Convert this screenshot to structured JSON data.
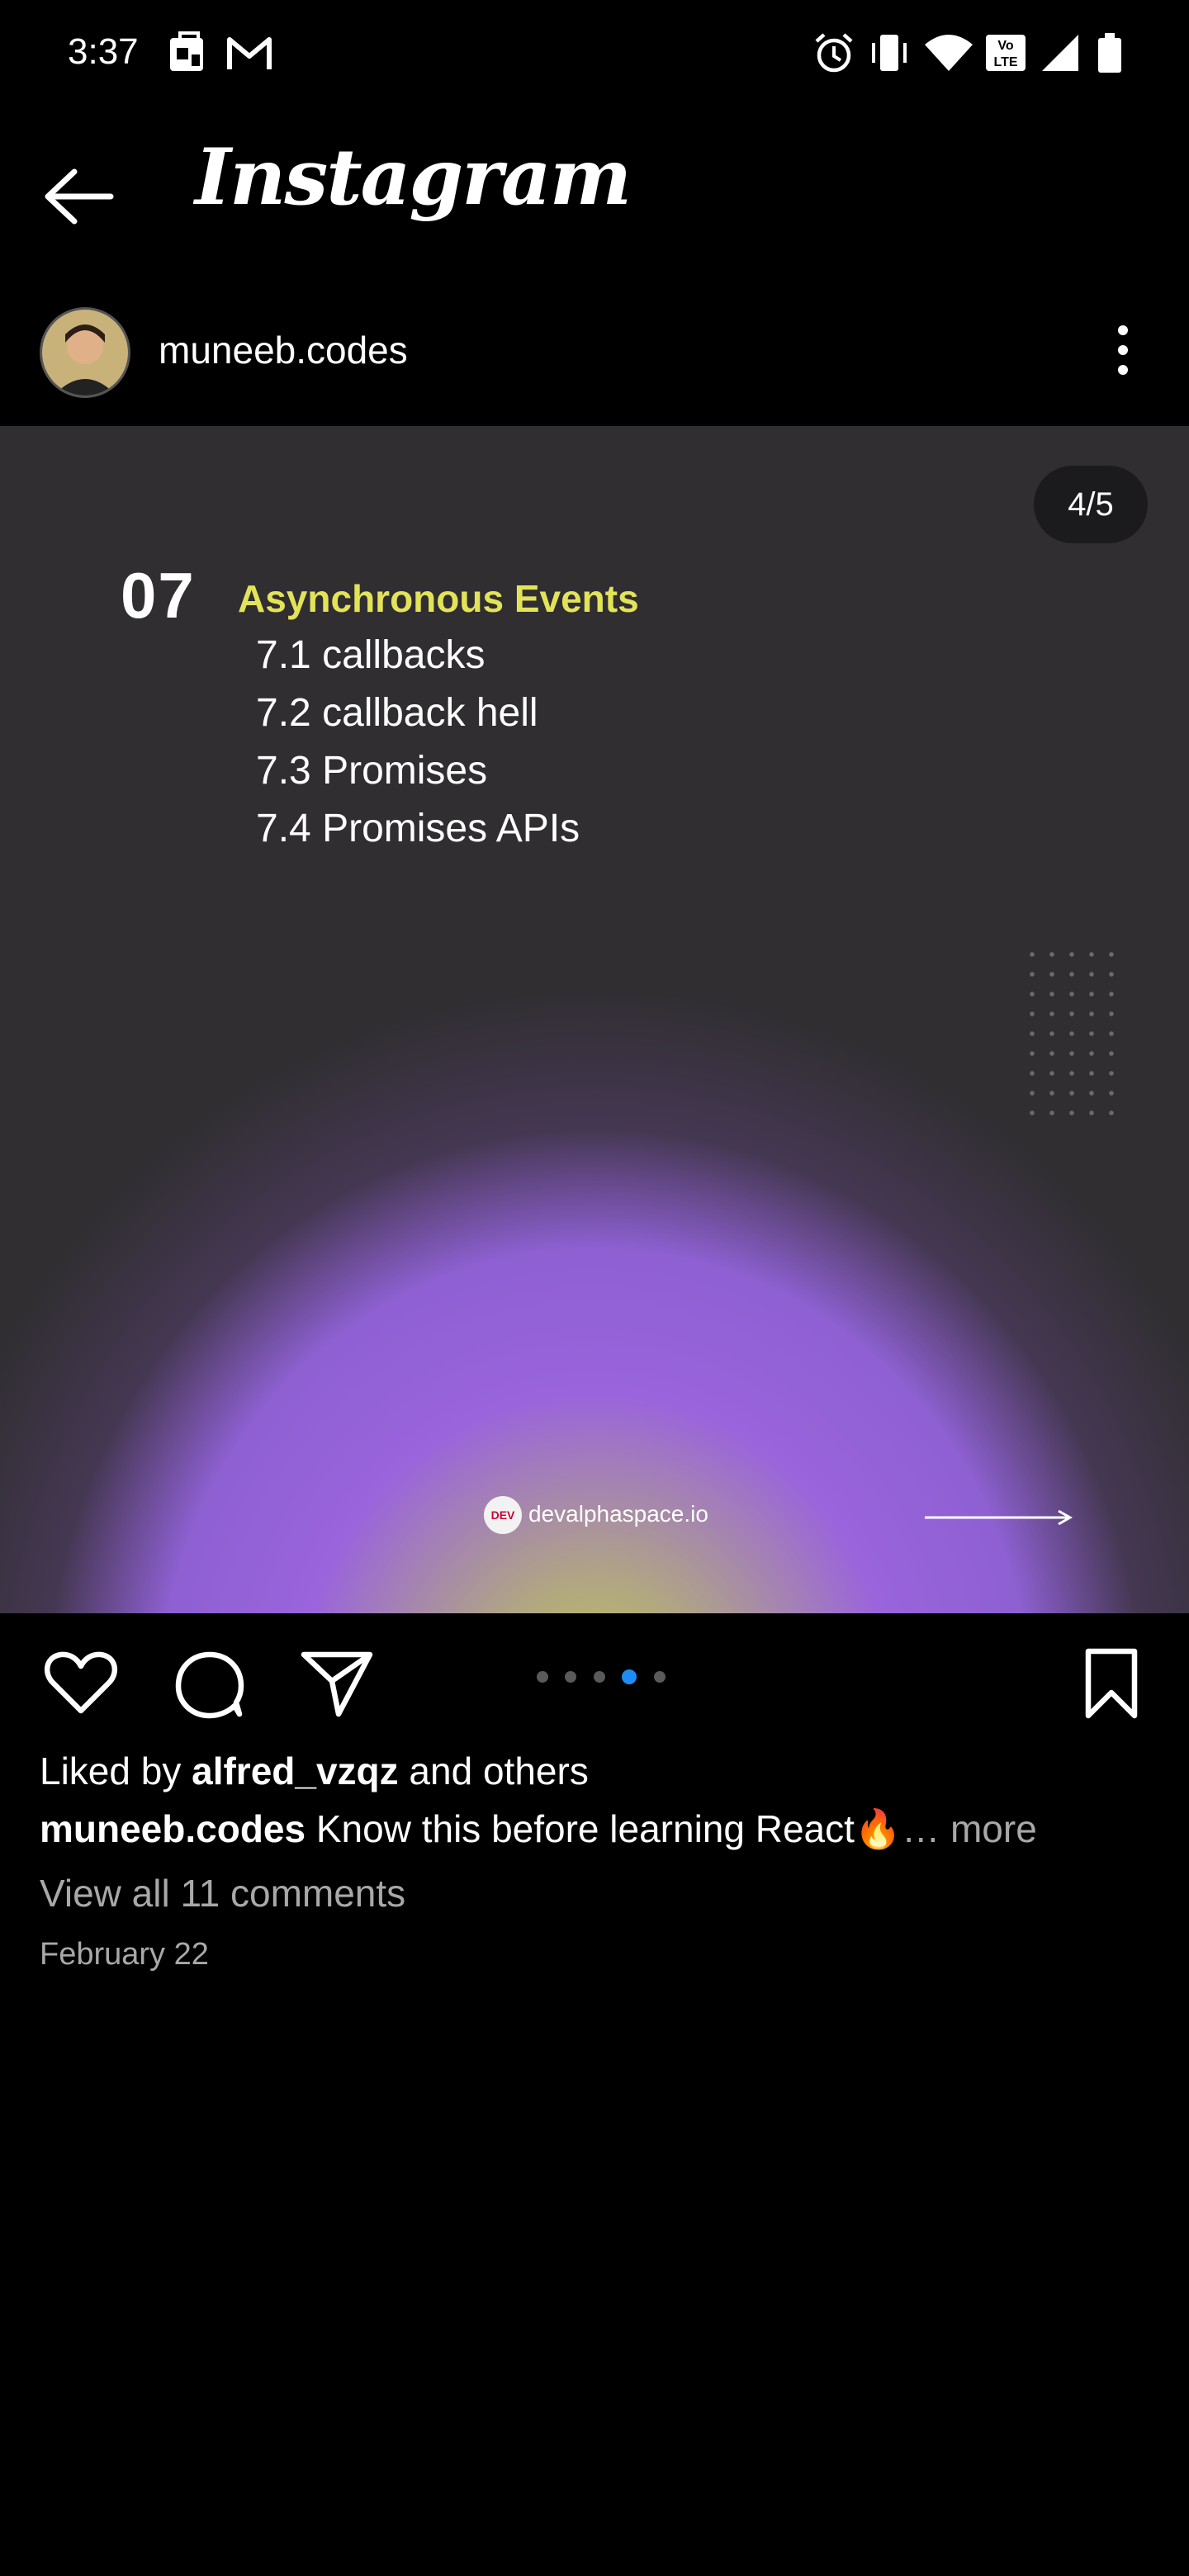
{
  "status_bar": {
    "time": "3:37",
    "left_icons": [
      "notification-icon",
      "gmail-icon"
    ],
    "right_icons": [
      "alarm-icon",
      "vibrate-icon",
      "wifi-icon",
      "volte-icon",
      "signal-icon",
      "battery-icon"
    ]
  },
  "header": {
    "app_title": "Instagram",
    "back_icon": "arrow-left-icon"
  },
  "post": {
    "username": "muneeb.codes",
    "more_icon": "vertical-dots-icon",
    "slide": {
      "counter": "4/5",
      "number": "07",
      "title": "Asynchronous Events",
      "items": [
        "7.1 callbacks",
        "7.2 callback hell",
        "7.3 Promises",
        "7.4 Promises APIs"
      ],
      "brand_logo_text": "DEV",
      "brand": "devalphaspace.io"
    },
    "carousel": {
      "total": 5,
      "active_index": 3,
      "active_color": "#1d8df5"
    },
    "likes": {
      "prefix": "Liked by ",
      "user": "alfred_vzqz",
      "suffix": " and others"
    },
    "caption": {
      "user": "muneeb.codes",
      "text": " Know this before learning React🔥",
      "more": "… more"
    },
    "comments_link": "View all 11 comments",
    "date": "February 22"
  },
  "colors": {
    "background": "#000000",
    "slide_title": "#e3e35a",
    "secondary_text": "#a8a8a8"
  }
}
